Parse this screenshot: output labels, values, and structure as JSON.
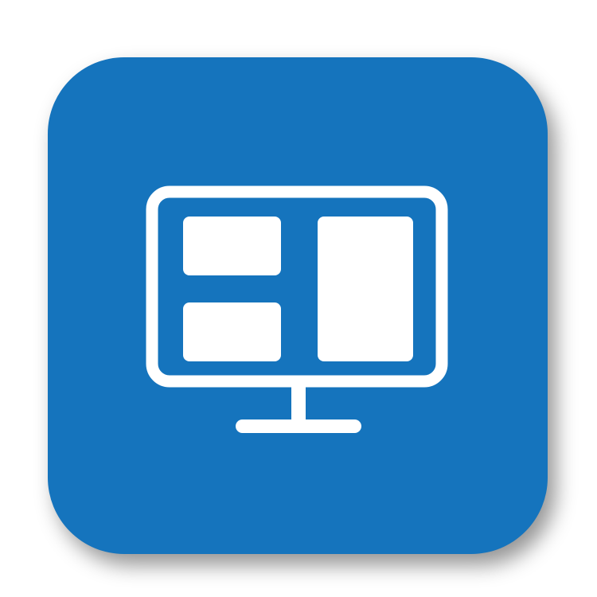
{
  "icon": {
    "name": "dashboard-monitor-icon",
    "tile_color": "#1574bd",
    "glyph_color": "#ffffff"
  }
}
